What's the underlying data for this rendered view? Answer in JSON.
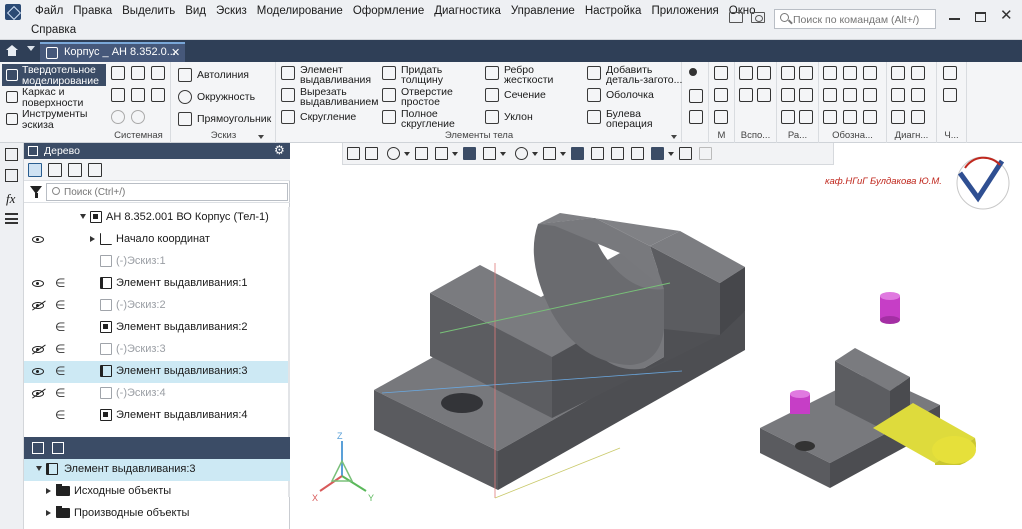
{
  "app": {
    "menu_row1": [
      "Файл",
      "Правка",
      "Выделить",
      "Вид",
      "Эскиз",
      "Моделирование",
      "Оформление",
      "Диагностика",
      "Управление",
      "Настройка",
      "Приложения",
      "Окно"
    ],
    "menu_row2": [
      "Справка"
    ],
    "command_search_placeholder": "Поиск по командам (Alt+/)"
  },
  "tabs": {
    "document_tab": "Корпус _ АН 8.352.0...",
    "close_glyph": "✕"
  },
  "ribbon": {
    "modes": [
      {
        "line1": "Твердотельное",
        "line2": "моделирование",
        "active": true
      },
      {
        "line1": "Каркас и",
        "line2": "поверхности",
        "active": false
      },
      {
        "line1": "Инструменты",
        "line2": "эскиза",
        "active": false
      }
    ],
    "group_labels": {
      "system": "Системная",
      "sketch": "Эскиз",
      "body_elements": "Элементы тела",
      "m": "М",
      "aux": "Вспо...",
      "ra": "Ра...",
      "designations": "Обозна...",
      "diag": "Диагн...",
      "ch": "Ч..."
    },
    "sketch_buttons": [
      "Автолиния",
      "Окружность",
      "Прямоугольник"
    ],
    "body_buttons": [
      {
        "line1": "Элемент",
        "line2": "выдавливания"
      },
      {
        "line1": "Вырезать",
        "line2": "выдавливанием"
      },
      {
        "line1": "Скругление",
        "line2": ""
      },
      {
        "line1": "Придать",
        "line2": "толщину"
      },
      {
        "line1": "Отверстие",
        "line2": "простое"
      },
      {
        "line1": "Полное",
        "line2": "скругление"
      },
      {
        "line1": "Ребро",
        "line2": "жесткости"
      },
      {
        "line1": "Сечение",
        "line2": ""
      },
      {
        "line1": "Уклон",
        "line2": ""
      },
      {
        "line1": "Добавить",
        "line2": "деталь-загото..."
      },
      {
        "line1": "Оболочка",
        "line2": ""
      },
      {
        "line1": "Булева",
        "line2": "операция"
      }
    ]
  },
  "tree": {
    "title": "Дерево",
    "search_placeholder": "Поиск (Ctrl+/)",
    "rows": [
      {
        "label": "АН 8.352.001 ВО Корпус (Тел-1)",
        "indent": 1,
        "eye": "none",
        "icon": "dark",
        "expand": "down",
        "dep": false,
        "grey": false,
        "sel": false
      },
      {
        "label": "Начало координат",
        "indent": 2,
        "eye": "on",
        "icon": "axis",
        "expand": "right",
        "dep": false,
        "grey": false,
        "sel": false
      },
      {
        "label": "(-)Эскиз:1",
        "indent": 2,
        "eye": "none",
        "icon": "sketch",
        "expand": "none",
        "dep": false,
        "grey": true,
        "sel": false
      },
      {
        "label": "Элемент выдавливания:1",
        "indent": 2,
        "eye": "on",
        "icon": "extrude",
        "expand": "none",
        "dep": true,
        "grey": false,
        "sel": false
      },
      {
        "label": "(-)Эскиз:2",
        "indent": 2,
        "eye": "off",
        "icon": "sketch",
        "expand": "none",
        "dep": true,
        "grey": true,
        "sel": false
      },
      {
        "label": "Элемент выдавливания:2",
        "indent": 2,
        "eye": "none",
        "icon": "dark",
        "expand": "none",
        "dep": true,
        "grey": false,
        "sel": false
      },
      {
        "label": "(-)Эскиз:3",
        "indent": 2,
        "eye": "off",
        "icon": "sketch",
        "expand": "none",
        "dep": true,
        "grey": true,
        "sel": false
      },
      {
        "label": "Элемент выдавливания:3",
        "indent": 2,
        "eye": "on",
        "icon": "extrude",
        "expand": "none",
        "dep": true,
        "grey": false,
        "sel": true
      },
      {
        "label": "(-)Эскиз:4",
        "indent": 2,
        "eye": "off",
        "icon": "sketch",
        "expand": "none",
        "dep": true,
        "grey": true,
        "sel": false
      },
      {
        "label": "Элемент выдавливания:4",
        "indent": 2,
        "eye": "none",
        "icon": "dark",
        "expand": "none",
        "dep": true,
        "grey": false,
        "sel": false
      }
    ]
  },
  "tree2": {
    "rows": [
      {
        "label": "Элемент выдавливания:3",
        "indent": 1,
        "icon": "extrude",
        "expand": "down",
        "sel": true
      },
      {
        "label": "Исходные объекты",
        "indent": 2,
        "icon": "folder",
        "expand": "right",
        "sel": false
      },
      {
        "label": "Производные объекты",
        "indent": 2,
        "icon": "folder",
        "expand": "right",
        "sel": false
      }
    ]
  },
  "viewport": {
    "dept_label": "каф.НГиГ Булдакова Ю.М.",
    "axis_labels": {
      "x": "X",
      "y": "Y",
      "z": "Z"
    },
    "colors": {
      "body": "#5f6064",
      "body_top": "#76777b",
      "body_dark": "#4a4b4f",
      "pin": "#c63ec6",
      "yellow": "#e6e03a",
      "accent": "#3b4c66",
      "selection": "#cde9f4"
    }
  }
}
